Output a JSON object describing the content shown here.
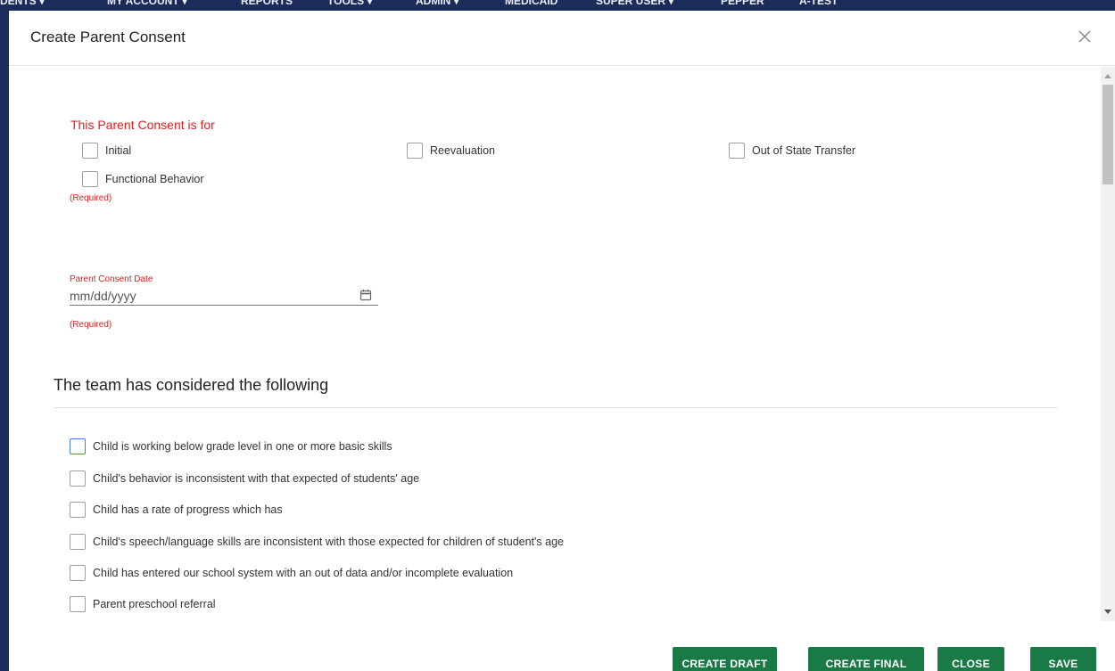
{
  "navbar": {
    "items": [
      "DENTS ▾",
      "MY ACCOUNT ▾",
      "REPORTS",
      "TOOLS ▾",
      "ADMIN ▾",
      "MEDICAID",
      "SUPER USER ▾",
      "PEPPER",
      "A-TEST"
    ]
  },
  "modal": {
    "title": "Create Parent Consent",
    "close_icon": "close-icon"
  },
  "consent_for": {
    "heading": "This Parent Consent is for",
    "options": [
      "Initial",
      "Reevaluation",
      "Out of State Transfer",
      "Functional Behavior"
    ],
    "required_text": "(Required)"
  },
  "consent_date": {
    "label": "Parent Consent Date",
    "placeholder": "mm/dd/yyyy",
    "required_text": "(Required)",
    "icon": "calendar-icon"
  },
  "considered": {
    "heading": "The team has considered the following",
    "items": [
      "Child is working below grade level in one or more basic skills",
      "Child's behavior is inconsistent with that expected of students' age",
      "Child has a rate of progress which has",
      "Child's speech/language skills are inconsistent with those expected for children of student's age",
      "Child has entered our school system with an out of data and/or incomplete evaluation",
      "Parent preschool referral"
    ]
  },
  "footer": {
    "create_draft": "CREATE DRAFT",
    "create_final": "CREATE FINAL",
    "close": "CLOSE",
    "save": "SAVE"
  },
  "colors": {
    "primary_button": "#1a7a46",
    "required_red": "#e02020",
    "navbar": "#1c2c5a",
    "focus_blue": "#4a7fd6"
  }
}
